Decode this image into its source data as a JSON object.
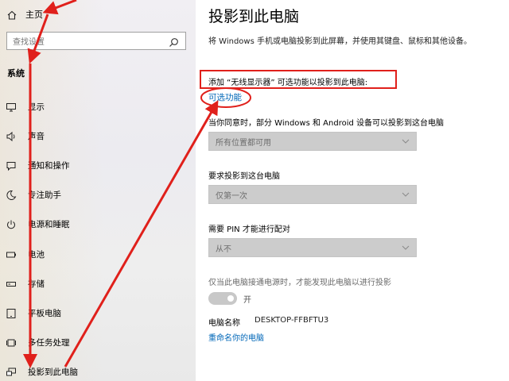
{
  "sidebar": {
    "home_label": "主页",
    "search_placeholder": "查找设置",
    "section_title": "系统",
    "items": [
      {
        "label": "显示"
      },
      {
        "label": "声音"
      },
      {
        "label": "通知和操作"
      },
      {
        "label": "专注助手"
      },
      {
        "label": "电源和睡眠"
      },
      {
        "label": "电池"
      },
      {
        "label": "存储"
      },
      {
        "label": "平板电脑"
      },
      {
        "label": "多任务处理"
      },
      {
        "label": "投影到此电脑"
      }
    ]
  },
  "main": {
    "title": "投影到此电脑",
    "description": "将 Windows 手机或电脑投影到此屏幕，并使用其键盘、鼠标和其他设备。",
    "add_feature_text": "添加 “无线显示器” 可选功能以投影到此电脑:",
    "optional_features_link": "可选功能",
    "consent_label": "当你同意时，部分 Windows 和 Android 设备可以投影到这台电脑",
    "consent_value": "所有位置都可用",
    "ask_label": "要求投影到这台电脑",
    "ask_value": "仅第一次",
    "pin_label": "需要 PIN 才能进行配对",
    "pin_value": "从不",
    "power_label": "仅当此电脑接通电源时，才能发现此电脑以进行投影",
    "power_toggle_state": "开",
    "pc_name_label": "电脑名称",
    "pc_name_value": "DESKTOP-FFBFTU3",
    "rename_link": "重命名你的电脑"
  },
  "colors": {
    "link": "#0067b8",
    "annotation_red": "#e0201b",
    "dropdown_bg": "#cccccc"
  }
}
